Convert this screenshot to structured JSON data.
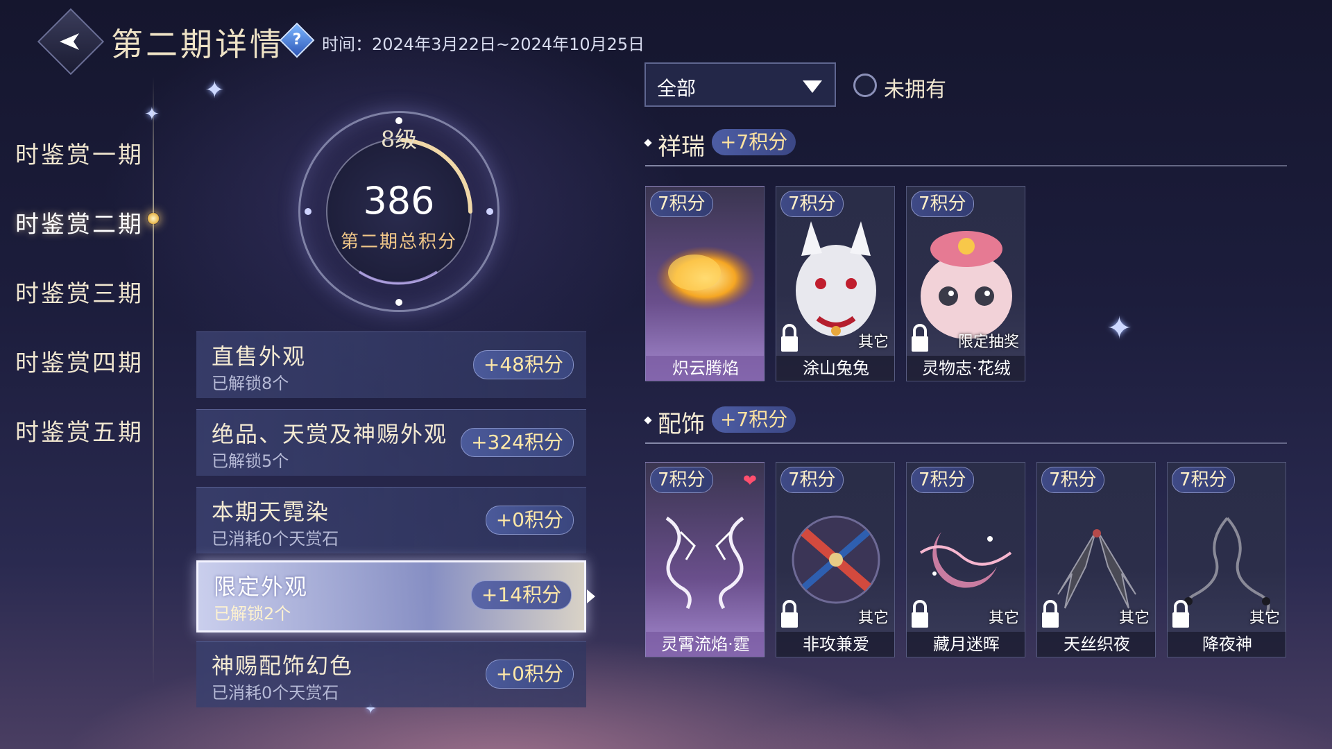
{
  "header": {
    "title": "第二期详情",
    "time_text": "时间：2024年3月22日~2024年10月25日"
  },
  "nav": {
    "items": [
      {
        "label": "时鉴赏一期"
      },
      {
        "label": "时鉴赏二期",
        "active": true
      },
      {
        "label": "时鉴赏三期"
      },
      {
        "label": "时鉴赏四期"
      },
      {
        "label": "时鉴赏五期"
      }
    ]
  },
  "score": {
    "level": "8级",
    "total": "386",
    "total_label": "第二期总积分"
  },
  "categories": [
    {
      "title": "直售外观",
      "sub": "已解锁8个",
      "badge": "+48积分"
    },
    {
      "title": "绝品、天赏及神赐外观",
      "sub": "已解锁5个",
      "badge": "+324积分"
    },
    {
      "title": "本期天霓染",
      "sub": "已消耗0个天赏石",
      "badge": "+0积分"
    },
    {
      "title": "限定外观",
      "sub": "已解锁2个",
      "badge": "+14积分",
      "active": true
    },
    {
      "title": "神赐配饰幻色",
      "sub": "已消耗0个天赏石",
      "badge": "+0积分"
    }
  ],
  "filter": {
    "selected": "全部",
    "not_owned_label": "未拥有"
  },
  "sections": [
    {
      "title": "祥瑞",
      "badge": "+7积分",
      "items": [
        {
          "points": "7积分",
          "name": "炽云腾焰",
          "source": "",
          "owned": true,
          "art": "golden-cloud"
        },
        {
          "points": "7积分",
          "name": "涂山兔兔",
          "source": "其它",
          "owned": false,
          "art": "white-rabbit"
        },
        {
          "points": "7积分",
          "name": "灵物志·花绒",
          "source": "限定抽奖",
          "owned": false,
          "art": "pink-pet"
        }
      ]
    },
    {
      "title": "配饰",
      "badge": "+7积分",
      "items": [
        {
          "points": "7积分",
          "name": "灵霄流焰·霆",
          "source": "",
          "owned": true,
          "favorite": true,
          "art": "lightning-wings"
        },
        {
          "points": "7积分",
          "name": "非攻兼爱",
          "source": "其它",
          "owned": false,
          "art": "cross-wheel"
        },
        {
          "points": "7积分",
          "name": "藏月迷晖",
          "source": "其它",
          "owned": false,
          "art": "pink-moon"
        },
        {
          "points": "7积分",
          "name": "天丝织夜",
          "source": "其它",
          "owned": false,
          "art": "dark-wings"
        },
        {
          "points": "7积分",
          "name": "降夜神",
          "source": "其它",
          "owned": false,
          "art": "smoke-wings"
        }
      ]
    }
  ],
  "colors": {
    "accent_gold": "#f2c889",
    "badge_blue": "#3f4a86",
    "heart_red": "#ff4f6e"
  },
  "icons": {
    "back": "back-arrow-icon",
    "help": "help-icon",
    "lock": "lock-icon",
    "favorite": "heart-icon",
    "dropdown": "chevron-down-icon"
  }
}
